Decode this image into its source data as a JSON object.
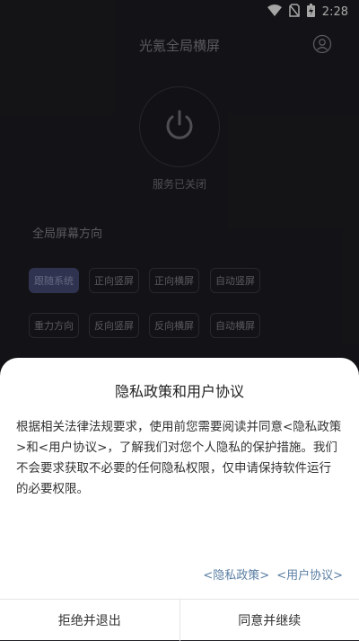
{
  "status_bar": {
    "time": "2:28",
    "icons": [
      "wifi-icon",
      "no-sim-icon",
      "battery-icon"
    ]
  },
  "app": {
    "title": "光氪全局横屏",
    "user_icon": "user-icon"
  },
  "power": {
    "icon": "power-icon",
    "status_text": "服务已关闭"
  },
  "orientation": {
    "section_title": "全局屏幕方向",
    "row1": [
      "跟随系统",
      "正向竖屏",
      "正向横屏",
      "自动竖屏"
    ],
    "row2": [
      "重力方向",
      "反向竖屏",
      "反向横屏",
      "自动横屏"
    ],
    "selected": "跟随系统"
  },
  "dialog": {
    "title": "隐私政策和用户协议",
    "body": "根据相关法律法规要求，使用前您需要阅读并同意<隐私政策>和<用户协议>，了解我们对您个人隐私的保护措施。我们不会要求获取不必要的任何隐私权限，仅申请保持软件运行的必要权限。",
    "privacy_link": "<隐私政策>",
    "agreement_link": "<用户协议>",
    "reject_button": "拒绝并退出",
    "accept_button": "同意并继续"
  },
  "colors": {
    "background": "#1e1e24",
    "accent_chip": "#4a4f7a",
    "link": "#5a7ea3"
  }
}
